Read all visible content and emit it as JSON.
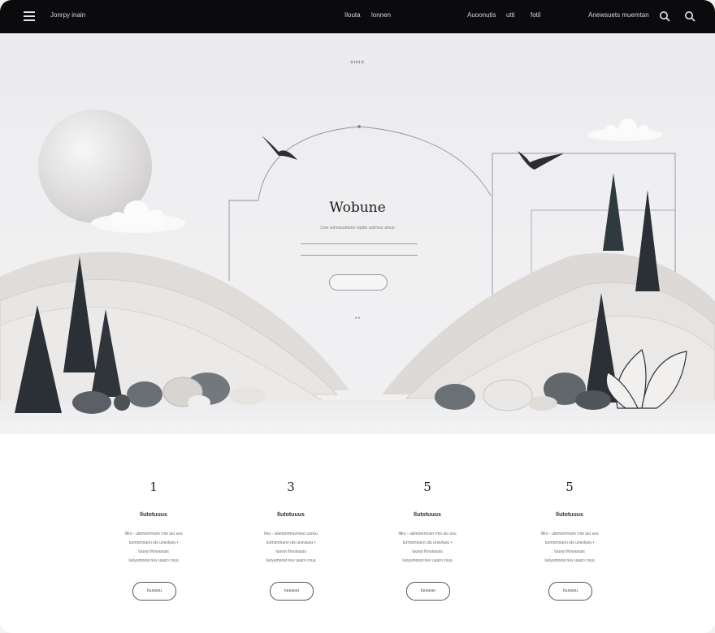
{
  "nav": {
    "brand": "Jonrpy inain",
    "links_center": [
      "Ilouta",
      "lonnen"
    ],
    "links_right": [
      "Auoonutis",
      "utti",
      "fotil"
    ],
    "account": "Anewsuets muemtan",
    "search_icon_1": "search-icon",
    "search_icon_2": "search-icon"
  },
  "hero": {
    "eyebrow": "uuuu",
    "title": "Wobune",
    "subtitle": "Lore sunnosuetonn ooptio ustrmuu amuo",
    "dots": "• •"
  },
  "features": [
    {
      "number": "1",
      "title": "Ilutotuuus",
      "lines": [
        "Illiro - ulsmonrmuvn rmo ulu uvu",
        "Iurmomnuno uts unsvluou •",
        "Iuuoyi Ihouiuuuis",
        "Iuoyumoost nuv uuuro cvuu"
      ],
      "button": "Iuuuuuu"
    },
    {
      "number": "3",
      "title": "Ilutotuuus",
      "lines": [
        "Iiiro - ulsmonrmuvnnoo uuovu",
        "Iurmomnuno uts unsvluou •",
        "Iuuoyi Ihouiuuuis",
        "Iuoyumoost nuv uuuro cvuu"
      ],
      "button": "Iuuuuuu"
    },
    {
      "number": "5",
      "title": "Ilutotuuus",
      "lines": [
        "Illiro - ulsmonrmuvn rmo ulu uvu",
        "Iurmomnuno uts unsvluou •",
        "Iuuoyi Ihouiuuuis",
        "Iuoyumoost nuv uuuro cvuu"
      ],
      "button": "Iuuuuuu"
    },
    {
      "number": "5",
      "title": "Ilutotuuus",
      "lines": [
        "Illiro - ulsmonrmuvn rmo ulu uvu",
        "Iurmomnuno uts unsvluou •",
        "Iuuoyi Ihouiuuuis",
        "Iuoyumoost nuv uuuro cvuu"
      ],
      "button": "Iuuuuuu"
    }
  ],
  "colors": {
    "nav_bg": "#0b0b0d",
    "tree_dark": "#2b3036",
    "hill_light": "#e4e1df"
  }
}
